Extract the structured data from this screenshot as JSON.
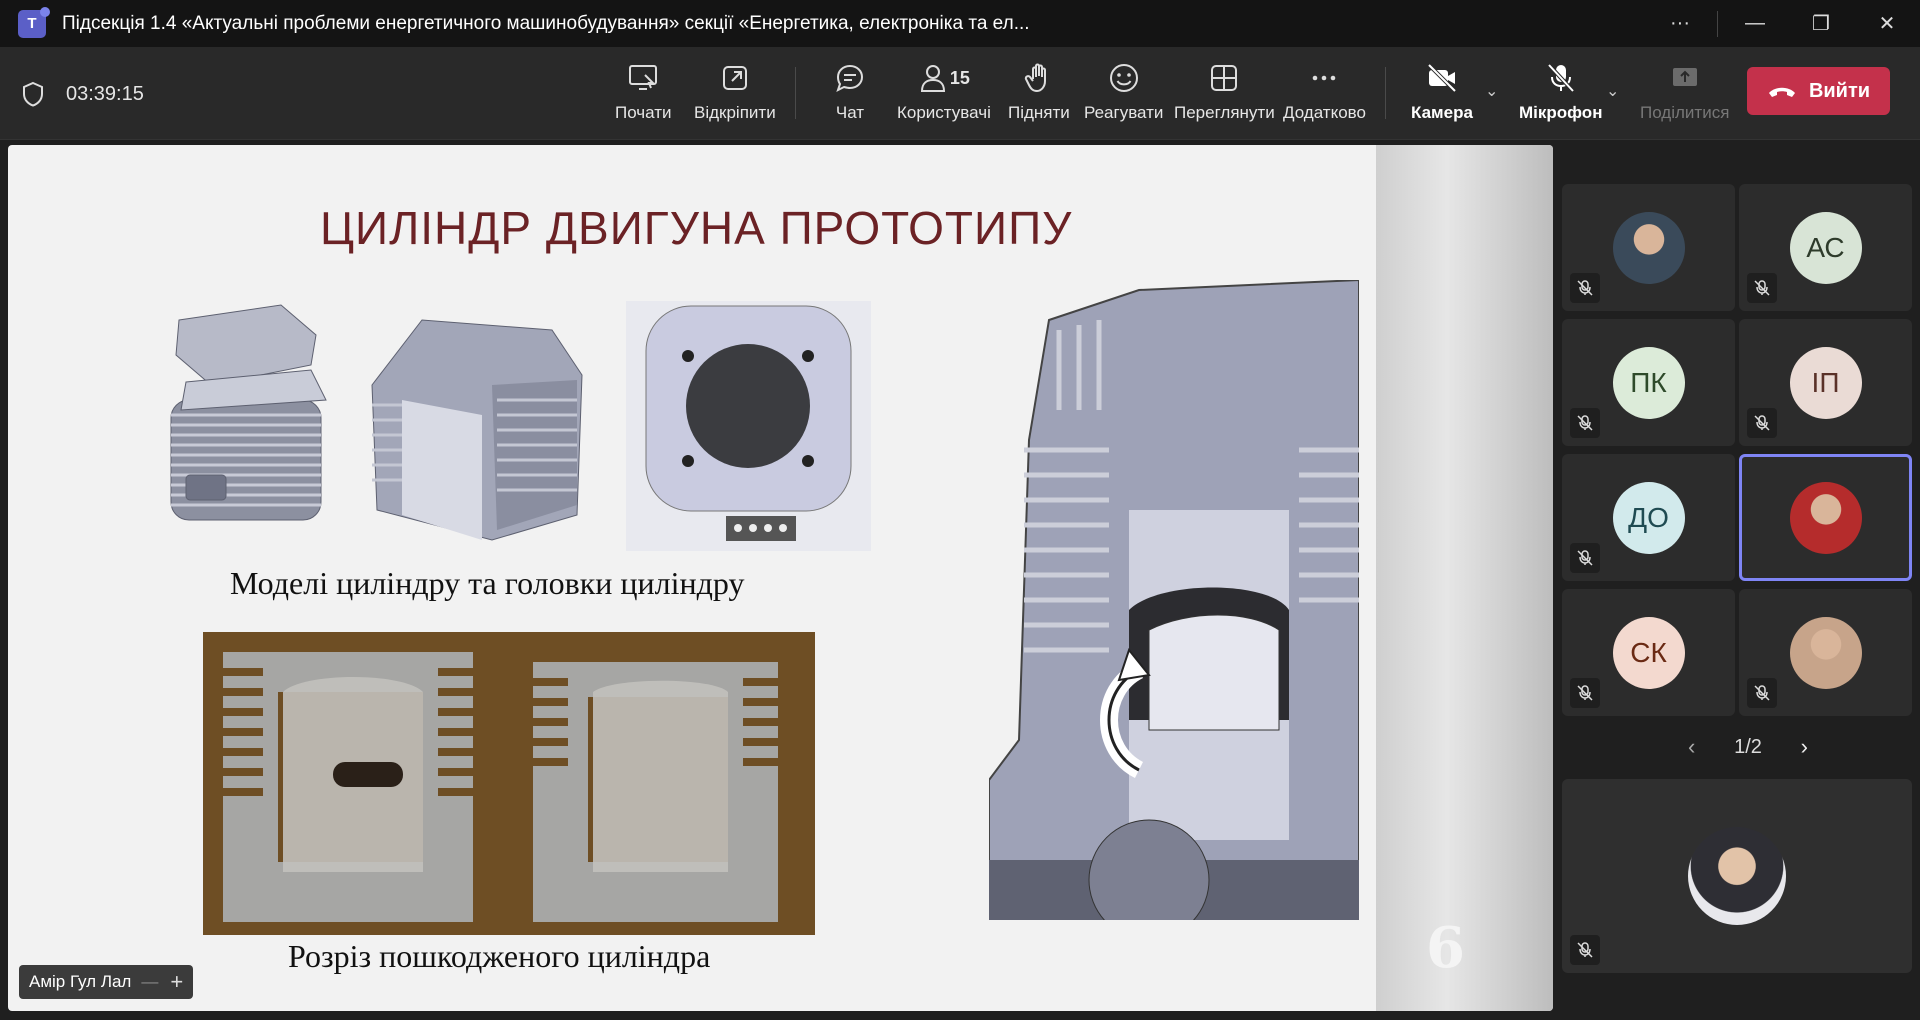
{
  "window": {
    "title": "Підсекція 1.4 «Актуальні проблеми енергетичного машинобудування» секції «Енергетика, електроніка та ел...",
    "app_icon": "teams-icon",
    "controls": {
      "more": "···",
      "minimize": "—",
      "restore": "❐",
      "close": "✕"
    }
  },
  "toolbar": {
    "timer": "03:39:15",
    "buttons": {
      "present": "Почати",
      "popout": "Відкріпити",
      "chat": "Чат",
      "people": "Користувачі",
      "people_count": "15",
      "raise": "Підняти",
      "react": "Реагувати",
      "view": "Переглянути",
      "more": "Додатково",
      "camera": "Камера",
      "mic": "Мікрофон",
      "share": "Поділитися",
      "leave": "Вийти"
    },
    "colors": {
      "leave": "#c4314b",
      "accent": "#7f85f5"
    }
  },
  "slide": {
    "title": "ЦИЛІНДР ДВИГУНА ПРОТОТИПУ",
    "caption_models": "Моделі циліндру та головки циліндру",
    "caption_section": "Розріз пошкодженого циліндра",
    "page_number": "6"
  },
  "presenter": {
    "name": "Амір Гул Лал"
  },
  "participants": [
    {
      "type": "photo",
      "initials": "",
      "bg": "#3a4a5a"
    },
    {
      "type": "initials",
      "initials": "АС",
      "bg": "#d8e4d6",
      "fg": "#2e3b2b"
    },
    {
      "type": "initials",
      "initials": "ПК",
      "bg": "#dcebd9",
      "fg": "#2e4a2a"
    },
    {
      "type": "initials",
      "initials": "ІП",
      "bg": "#eadbd5",
      "fg": "#5a3128"
    },
    {
      "type": "initials",
      "initials": "ДО",
      "bg": "#d2eaec",
      "fg": "#1f4b52"
    },
    {
      "type": "photo",
      "initials": "",
      "bg": "#b52c2c"
    },
    {
      "type": "initials",
      "initials": "СК",
      "bg": "#f3d9cf",
      "fg": "#6a2a14"
    },
    {
      "type": "photo",
      "initials": "",
      "bg": "#c7a48a"
    }
  ],
  "pager": {
    "label": "1/2",
    "prev": "‹",
    "next": "›"
  },
  "spotlight": {
    "type": "photo"
  }
}
